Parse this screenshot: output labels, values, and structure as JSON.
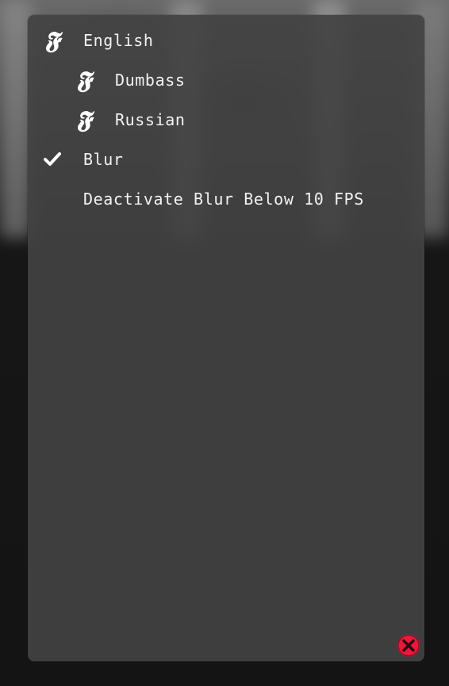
{
  "menu": {
    "items": [
      {
        "id": "english",
        "label": "English",
        "icon": "fraktur-f-icon",
        "glyph": "𝕱",
        "checked": false
      },
      {
        "id": "dumbass",
        "label": "Dumbass",
        "icon": "fraktur-f-icon",
        "glyph": "𝕱",
        "checked": false
      },
      {
        "id": "russian",
        "label": "Russian",
        "icon": "fraktur-f-icon",
        "glyph": "𝕱",
        "checked": false
      },
      {
        "id": "blur",
        "label": "Blur",
        "icon": "checkmark-icon",
        "glyph": "✔",
        "checked": true
      },
      {
        "id": "deactivate-blur",
        "label": "Deactivate Blur Below 10 FPS",
        "icon": "",
        "glyph": "",
        "checked": false
      }
    ]
  },
  "close_button": {
    "icon": "close-icon"
  },
  "colors": {
    "panel": "#424242",
    "text": "#f2f2f2",
    "close": "#e8193c"
  }
}
